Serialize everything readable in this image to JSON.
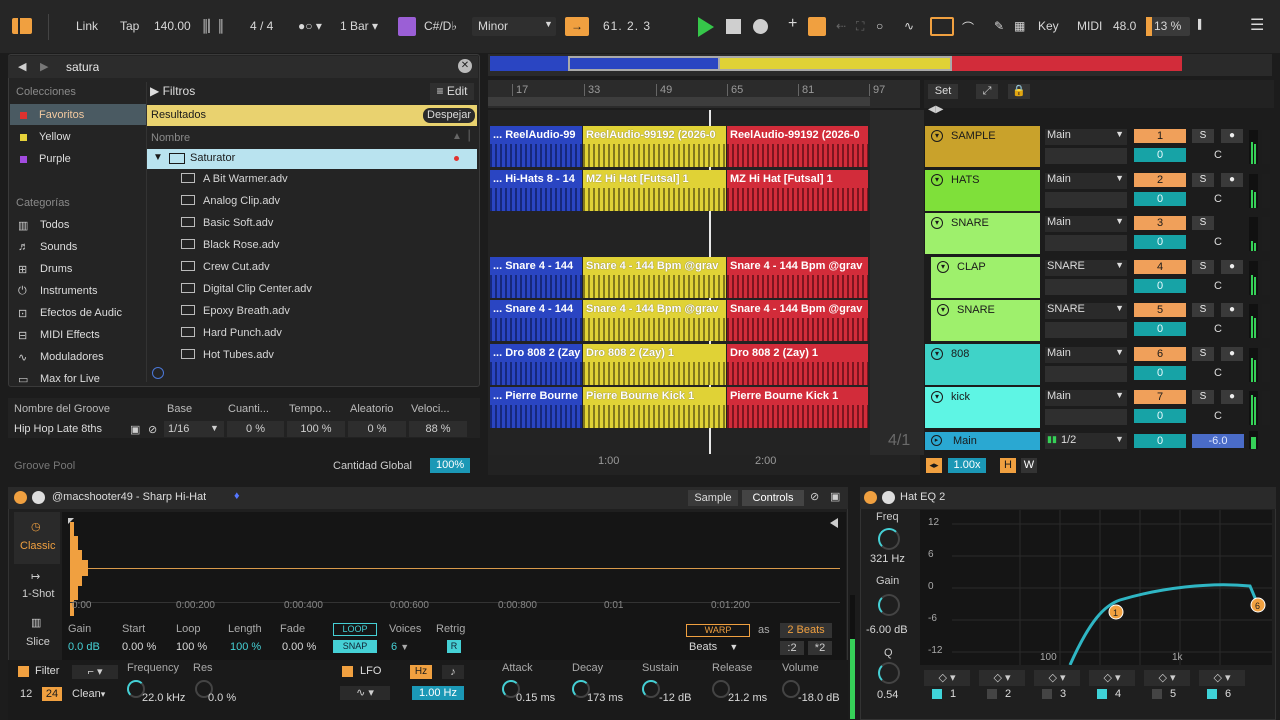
{
  "transport": {
    "link": "Link",
    "tap": "Tap",
    "tempo": "140.00",
    "signature": "4 / 4",
    "quantization": "1 Bar",
    "key_root": "C#/D♭",
    "scale": "Minor",
    "position": "61. 2. 3",
    "key_label": "Key",
    "midi_label": "MIDI",
    "cpu_value": "48.0",
    "cpu_pct": "13 %"
  },
  "browser": {
    "search_value": "satura",
    "collections_header": "Colecciones",
    "collections": [
      {
        "label": "Favoritos",
        "color": "#e0322f"
      },
      {
        "label": "Yellow",
        "color": "#e6d23a"
      },
      {
        "label": "Purple",
        "color": "#a24be0"
      }
    ],
    "categories_header": "Categorías",
    "categories": [
      "Todos",
      "Sounds",
      "Drums",
      "Instruments",
      "Efectos de Audic",
      "MIDI Effects",
      "Moduladores",
      "Max for Live"
    ],
    "filters_label": "Filtros",
    "edit_label": "Edit",
    "results_label": "Resultados",
    "clear_label": "Despejar",
    "name_header": "Nombre",
    "folder": "Saturator",
    "files": [
      "A Bit Warmer.adv",
      "Analog Clip.adv",
      "Basic Soft.adv",
      "Black Rose.adv",
      "Crew Cut.adv",
      "Digital Clip Center.adv",
      "Epoxy Breath.adv",
      "Hard Punch.adv",
      "Hot Tubes.adv"
    ]
  },
  "groove": {
    "headers": [
      "Nombre del Groove",
      "Base",
      "Cuanti...",
      "Tempo...",
      "Aleatorio",
      "Veloci..."
    ],
    "row": {
      "name": "Hip Hop Late 8ths",
      "base": "1/16",
      "quant": "0 %",
      "tempo": "100 %",
      "random": "0 %",
      "velocity": "88 %"
    },
    "pool_label": "Groove Pool",
    "global_label": "Cantidad Global",
    "global_value": "100%"
  },
  "arrangement": {
    "bar_numbers": [
      "17",
      "33",
      "49",
      "65",
      "81",
      "97"
    ],
    "time_marks": [
      "1:00",
      "2:00"
    ],
    "loop_marker": "4/1",
    "zoom": "1.00x",
    "clips": [
      {
        "row": 0,
        "a": "... ReelAudio-99",
        "b": "ReelAudio-99192 (2026-0",
        "c": "ReelAudio-99192 (2026-0"
      },
      {
        "row": 1,
        "a": "... Hi-Hats 8 - 14",
        "b": "MZ Hi Hat [Futsal] 1",
        "c": "MZ Hi Hat [Futsal] 1"
      },
      {
        "row": 3,
        "a": "... Snare 4 - 144",
        "b": "Snare 4 - 144 Bpm @grav",
        "c": "Snare 4 - 144 Bpm @grav"
      },
      {
        "row": 4,
        "a": "... Snare 4 - 144",
        "b": "Snare 4 - 144 Bpm @grav",
        "c": "Snare 4 - 144 Bpm @grav"
      },
      {
        "row": 5,
        "a": "... Dro 808 2 (Zay",
        "b": "Dro 808 2 (Zay) 1",
        "c": "Dro 808 2 (Zay) 1"
      },
      {
        "row": 6,
        "a": "... Pierre Bourne",
        "b": "Pierre Bourne Kick 1",
        "c": "Pierre Bourne Kick 1"
      }
    ]
  },
  "mixer": {
    "set_label": "Set",
    "tracks": [
      {
        "name": "SAMPLE",
        "color": "#c9a22b",
        "route": "Main",
        "num": "1",
        "vol": "0"
      },
      {
        "name": "HATS",
        "color": "#7fe03a",
        "route": "Main",
        "num": "2",
        "vol": "0"
      },
      {
        "name": "SNARE",
        "color": "#9ef06c",
        "route": "Main",
        "num": "3",
        "vol": "0"
      },
      {
        "name": "CLAP",
        "color": "#9ef06c",
        "route": "SNARE",
        "num": "4",
        "vol": "0"
      },
      {
        "name": "SNARE",
        "color": "#9ef06c",
        "route": "SNARE",
        "num": "5",
        "vol": "0"
      },
      {
        "name": "808",
        "color": "#3fd3c8",
        "route": "Main",
        "num": "6",
        "vol": "0"
      },
      {
        "name": "kick",
        "color": "#5ef5e4",
        "route": "Main",
        "num": "7",
        "vol": "0"
      }
    ],
    "s_label": "S",
    "c_label": "C",
    "main": {
      "name": "Main",
      "route": "1/2",
      "vol": "0",
      "db": "-6.0"
    }
  },
  "sampler": {
    "title": "@macshooter49 - Sharp Hi-Hat",
    "tab_sample": "Sample",
    "tab_controls": "Controls",
    "modes": [
      "Classic",
      "1-Shot",
      "Slice"
    ],
    "time_ticks": [
      "0:00",
      "0:00:200",
      "0:00:400",
      "0:00:600",
      "0:00:800",
      "0:01",
      "0:01:200"
    ],
    "gain_l": "Gain",
    "gain_v": "0.0 dB",
    "start_l": "Start",
    "start_v": "0.00 %",
    "loop_l": "Loop",
    "loop_v": "100 %",
    "length_l": "Length",
    "length_v": "100 %",
    "fade_l": "Fade",
    "fade_v": "0.00 %",
    "loop_btn": "LOOP",
    "snap_btn": "SNAP",
    "voices_l": "Voices",
    "voices_v": "6",
    "retrig_l": "Retrig",
    "retrig_v": "R",
    "warp_btn": "WARP",
    "as_l": "as",
    "beats_v": "2 Beats",
    "beats_mode": "Beats",
    "div2": ":2",
    "mul2": "*2",
    "filter_l": "Filter",
    "filter_a": "12",
    "filter_b": "24",
    "filter_type": "Clean",
    "freq_l": "Frequency",
    "freq_v": "22.0 kHz",
    "res_l": "Res",
    "res_v": "0.0 %",
    "lfo_l": "LFO",
    "hz_l": "Hz",
    "note_l": "♪",
    "lfo_v": "1.00 Hz",
    "attack_l": "Attack",
    "attack_v": "0.15 ms",
    "decay_l": "Decay",
    "decay_v": "173 ms",
    "sustain_l": "Sustain",
    "sustain_v": "-12 dB",
    "release_l": "Release",
    "release_v": "21.2 ms",
    "volume_l": "Volume",
    "volume_v": "-18.0 dB"
  },
  "eq": {
    "title": "Hat EQ 2",
    "freq_l": "Freq",
    "freq_v": "321 Hz",
    "gain_l": "Gain",
    "gain_v": "-6.00 dB",
    "q_l": "Q",
    "q_v": "0.54",
    "db_ticks": [
      "12",
      "6",
      "0",
      "-6",
      "-12"
    ],
    "hz_ticks": [
      "100",
      "1k"
    ],
    "bands": [
      "1",
      "2",
      "3",
      "4",
      "5",
      "6"
    ]
  }
}
